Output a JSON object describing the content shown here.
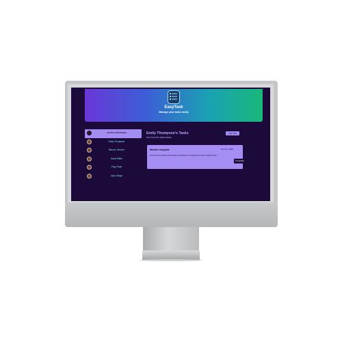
{
  "header": {
    "app_title": "EasyTask",
    "app_subtitle": "Manage your tasks easily"
  },
  "sidebar": {
    "items": [
      {
        "label": "Jasmine Washington",
        "active": true
      },
      {
        "label": "Emily Thompson",
        "active": false
      },
      {
        "label": "Marcus Johnson",
        "active": false
      },
      {
        "label": "David Miller",
        "active": false
      },
      {
        "label": "Priya Patel",
        "active": false
      },
      {
        "label": "Arjun Singh",
        "active": false
      }
    ]
  },
  "main": {
    "title": "Emily Thompson's Tasks",
    "subtitle": "Sort from the latest tasks",
    "add_button_label": "Add Task",
    "tasks": [
      {
        "name": "Master Angular",
        "date": "Dec 31, 2025",
        "description": "Learn all the basic and advanced features of Angular & how to apply them.",
        "complete_label": "Complete"
      }
    ]
  },
  "colors": {
    "screen_bg": "#1c0a3a",
    "accent": "#a38cf2",
    "sidebar_text": "#7de0ea"
  },
  "icons": {
    "logo": "task-list-icon"
  }
}
